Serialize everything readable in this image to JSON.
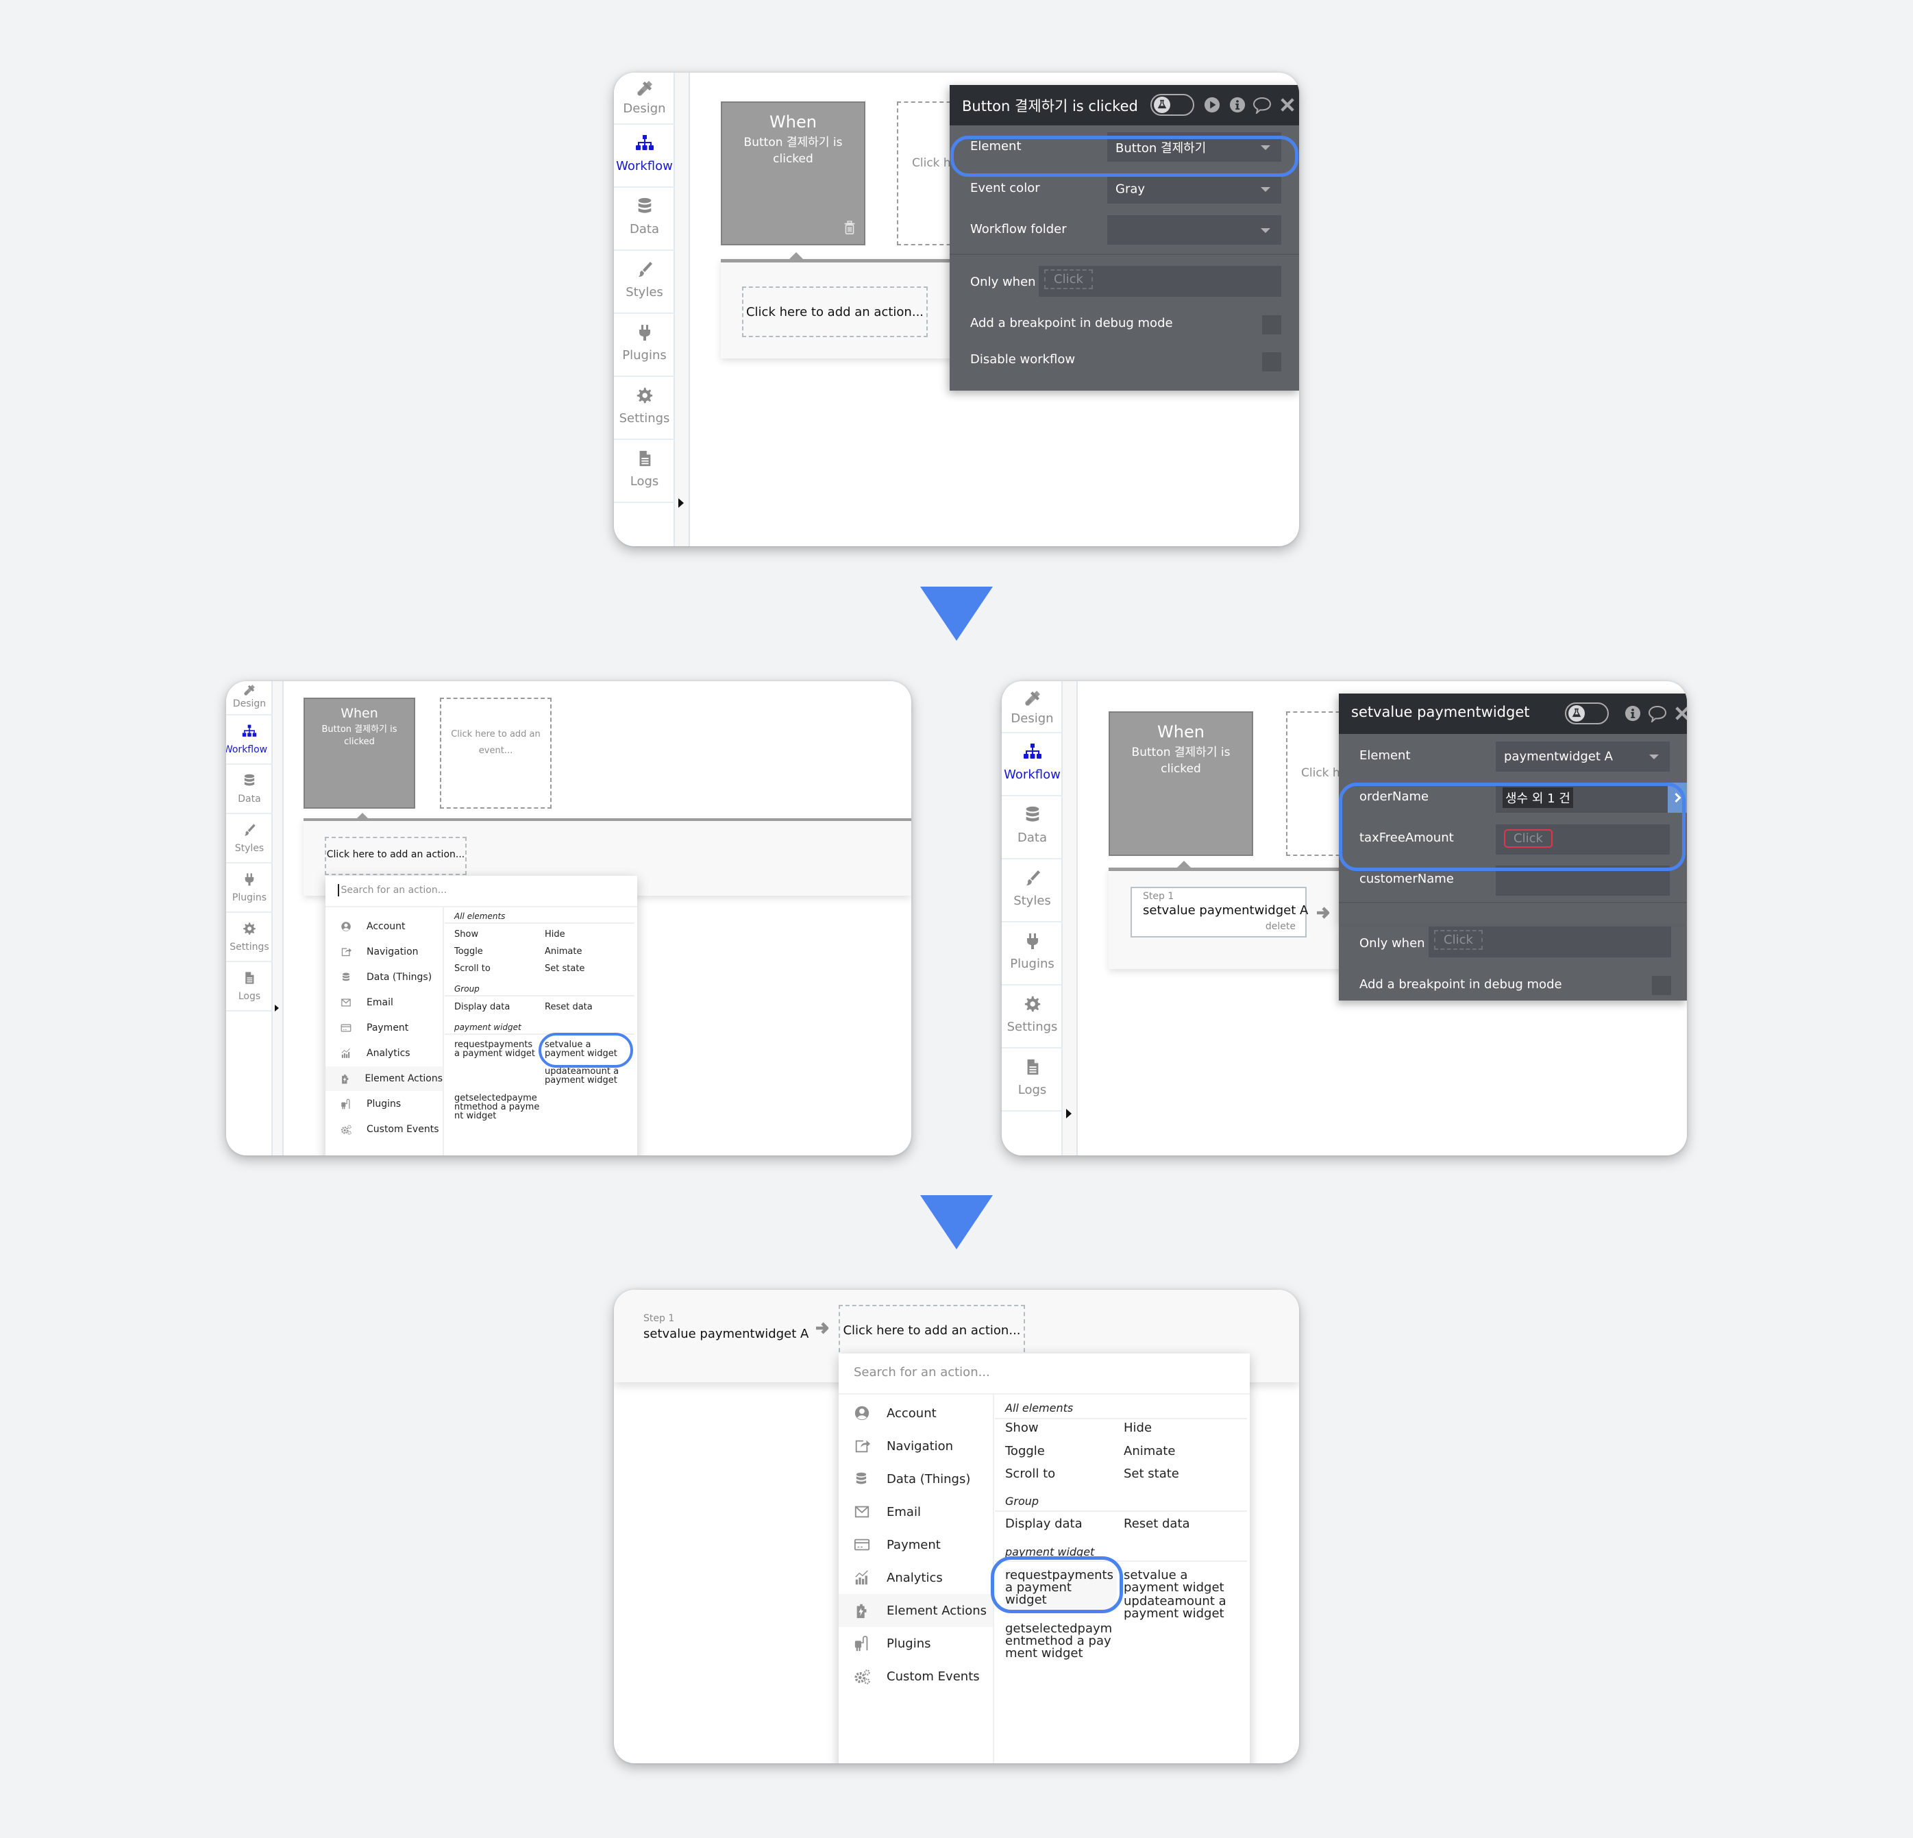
{
  "colors": {
    "page_bg": "#F2F3F5",
    "flow_arrow": "#4A83EE",
    "highlight_ring": "#4A83EE",
    "active_nav": "#1515D8",
    "dialog_header": "#2B2F33",
    "dialog_body": "#5F6367",
    "event_card": "#9C9C9C",
    "invalid_outline": "#E0344F"
  },
  "sidebar": {
    "items": [
      {
        "label": "Design",
        "icon": "design-tools-icon"
      },
      {
        "label": "Workflow",
        "icon": "workflow-tree-icon",
        "active": true
      },
      {
        "label": "Data",
        "icon": "database-icon"
      },
      {
        "label": "Styles",
        "icon": "paintbrush-icon"
      },
      {
        "label": "Plugins",
        "icon": "plug-icon"
      },
      {
        "label": "Settings",
        "icon": "gear-icon"
      },
      {
        "label": "Logs",
        "icon": "document-icon"
      }
    ]
  },
  "event": {
    "when": "When",
    "trigger": "Button 결제하기 is clicked",
    "add_event": "Click here to add an event...",
    "add_event_cut": "Click h"
  },
  "add_action": "Click here to add an action...",
  "step1": {
    "label": "Step 1",
    "name": "setvalue paymentwidget A",
    "delete": "delete"
  },
  "panel1": {
    "dialog": {
      "title": "Button 결제하기 is clicked",
      "rows": [
        {
          "label": "Element",
          "value": "Button 결제하기",
          "dropdown": true
        },
        {
          "label": "Event color",
          "value": "Gray",
          "dropdown": true
        },
        {
          "label": "Workflow folder",
          "value": "",
          "dropdown": true
        }
      ],
      "only_when_label": "Only when",
      "only_when_placeholder": "Click",
      "breakpoint_label": "Add a breakpoint in debug mode",
      "disable_label": "Disable workflow"
    }
  },
  "panel3": {
    "dialog": {
      "title": "setvalue paymentwidget",
      "element_label": "Element",
      "element_value": "paymentwidget A",
      "fields": [
        {
          "label": "orderName",
          "value": "생수 외 1 건"
        },
        {
          "label": "taxFreeAmount",
          "placeholder": "Click",
          "invalid": true
        },
        {
          "label": "customerName",
          "value": ""
        }
      ],
      "only_when_label": "Only when",
      "only_when_placeholder": "Click",
      "breakpoint_label": "Add a breakpoint in debug mode"
    }
  },
  "action_menu": {
    "search_placeholder": "Search for an action...",
    "categories": [
      {
        "label": "Account",
        "icon": "account-icon"
      },
      {
        "label": "Navigation",
        "icon": "navigation-icon"
      },
      {
        "label": "Data (Things)",
        "icon": "database-icon"
      },
      {
        "label": "Email",
        "icon": "email-icon"
      },
      {
        "label": "Payment",
        "icon": "credit-card-icon"
      },
      {
        "label": "Analytics",
        "icon": "analytics-icon"
      },
      {
        "label": "Element Actions",
        "icon": "element-actions-icon",
        "active": true
      },
      {
        "label": "Plugins",
        "icon": "plugins-icon"
      },
      {
        "label": "Custom Events",
        "icon": "custom-events-icon"
      }
    ],
    "sections": {
      "all_elements": {
        "title": "All elements",
        "options": [
          "Show",
          "Hide",
          "Toggle",
          "Animate",
          "Scroll to",
          "Set state"
        ]
      },
      "group": {
        "title": "Group",
        "options": [
          "Display data",
          "Reset data"
        ]
      },
      "payment_widget": {
        "title": "payment widget",
        "options": [
          "requestpayments a payment widget",
          "setvalue a payment widget",
          "updateamount a payment widget",
          "getselectedpaymentmethod a payment widget"
        ]
      }
    }
  }
}
